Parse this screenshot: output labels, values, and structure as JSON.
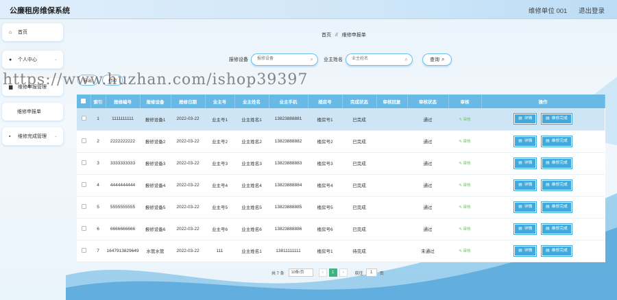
{
  "app": {
    "title": "公廉租房维保系统",
    "unit": "维修单位 001",
    "logout": "退出登录"
  },
  "sidebar": {
    "items": [
      {
        "icon": "home-icon",
        "label": "首页",
        "expandable": false
      },
      {
        "icon": "user-icon",
        "label": "个人中心",
        "expandable": true
      },
      {
        "icon": "list-icon",
        "label": "维修申报管理",
        "expandable": false
      },
      {
        "icon": "",
        "label": "维修申报单",
        "expandable": false
      },
      {
        "icon": "grid-icon",
        "label": "维修完成管理",
        "expandable": true
      }
    ]
  },
  "breadcrumb": {
    "home": "首页",
    "sep": "//",
    "current": "维修申报单"
  },
  "search": {
    "label1": "报修设备",
    "placeholder1": "报修设备",
    "label2": "业主姓名",
    "placeholder2": "业主姓名",
    "button": "查询"
  },
  "toolbar": {
    "btn1": "导出",
    "btn2": "打印"
  },
  "watermark": "https://www.huzhan.com/ishop39397",
  "table": {
    "headers": [
      "索引",
      "报修编号",
      "报修设备",
      "报修日期",
      "业主号",
      "业主姓名",
      "业主手机",
      "楼房号",
      "完成状态",
      "审核回复",
      "审核状态",
      "审核",
      "操作"
    ],
    "audit_label": "审核",
    "detail_label": "详情",
    "complete_label": "维修完成",
    "rows": [
      {
        "idx": "1",
        "no": "1111111111",
        "device": "报修设备1",
        "date": "2022-03-22",
        "owner_no": "业主号1",
        "owner_name": "业主姓名1",
        "phone": "13823888881",
        "building": "楼房号1",
        "status": "已完成",
        "reply": "",
        "audit_status": "通过"
      },
      {
        "idx": "2",
        "no": "2222222222",
        "device": "报修设备2",
        "date": "2022-03-22",
        "owner_no": "业主号2",
        "owner_name": "业主姓名2",
        "phone": "13823888882",
        "building": "楼房号2",
        "status": "已完成",
        "reply": "",
        "audit_status": "通过"
      },
      {
        "idx": "3",
        "no": "3333333333",
        "device": "报修设备3",
        "date": "2022-03-22",
        "owner_no": "业主号3",
        "owner_name": "业主姓名3",
        "phone": "13823888883",
        "building": "楼房号3",
        "status": "已完成",
        "reply": "",
        "audit_status": "通过"
      },
      {
        "idx": "4",
        "no": "4444444444",
        "device": "报修设备4",
        "date": "2022-03-22",
        "owner_no": "业主号4",
        "owner_name": "业主姓名4",
        "phone": "13823888884",
        "building": "楼房号4",
        "status": "已完成",
        "reply": "",
        "audit_status": "通过"
      },
      {
        "idx": "5",
        "no": "5555555555",
        "device": "报修设备5",
        "date": "2022-03-22",
        "owner_no": "业主号5",
        "owner_name": "业主姓名5",
        "phone": "13823888885",
        "building": "楼房号5",
        "status": "已完成",
        "reply": "",
        "audit_status": "通过"
      },
      {
        "idx": "6",
        "no": "6666666666",
        "device": "报修设备6",
        "date": "2022-03-22",
        "owner_no": "业主号6",
        "owner_name": "业主姓名6",
        "phone": "13823888886",
        "building": "楼房号6",
        "status": "已完成",
        "reply": "",
        "audit_status": "通过"
      },
      {
        "idx": "7",
        "no": "1647913829649",
        "device": "水管水管",
        "date": "2022-03-22",
        "owner_no": "111",
        "owner_name": "业主姓名1",
        "phone": "13811111111",
        "building": "楼房号1",
        "status": "待完成",
        "reply": "",
        "audit_status": "未通过"
      }
    ]
  },
  "pager": {
    "total": "共 7 条",
    "page_size": "10条/页",
    "prev": "‹",
    "current": "1",
    "next": "›",
    "goto": "前往",
    "goto_value": "1",
    "page_unit": "页"
  },
  "colors": {
    "accent": "#67b9e6",
    "button": "#42a9dd",
    "active_page": "#3fb37f",
    "audit_text": "#6fbf60"
  }
}
